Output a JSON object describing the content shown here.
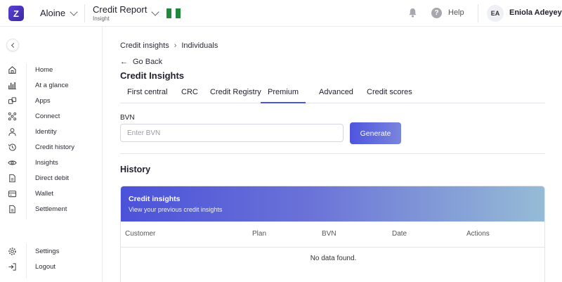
{
  "header": {
    "logo_glyph": "Z",
    "org_name": "Aloine",
    "product_title": "Credit Report",
    "product_subtitle": "Insight",
    "flag_colors": [
      "#1f8a3b",
      "#ffffff",
      "#1f8a3b"
    ],
    "help_glyph": "?",
    "help_label": "Help",
    "avatar_initials": "EA",
    "user_name": "Eniola Adeyeye"
  },
  "sidebar": {
    "items": [
      {
        "label": "Home",
        "icon": "home-icon"
      },
      {
        "label": "At a glance",
        "icon": "bar-chart-icon"
      },
      {
        "label": "Apps",
        "icon": "apps-icon"
      },
      {
        "label": "Connect",
        "icon": "connect-icon"
      },
      {
        "label": "Identity",
        "icon": "user-icon"
      },
      {
        "label": "Credit history",
        "icon": "history-icon"
      },
      {
        "label": "Insights",
        "icon": "eye-icon"
      },
      {
        "label": "Direct debit",
        "icon": "document-icon"
      },
      {
        "label": "Wallet",
        "icon": "wallet-icon"
      },
      {
        "label": "Settlement",
        "icon": "document-icon"
      }
    ],
    "footer_items": [
      {
        "label": "Settings",
        "icon": "gear-icon"
      },
      {
        "label": "Logout",
        "icon": "logout-icon"
      }
    ]
  },
  "breadcrumb": {
    "items": [
      "Credit insights",
      "Individuals"
    ],
    "separator": "›"
  },
  "go_back": {
    "arrow": "←",
    "label": "Go Back"
  },
  "page_title": "Credit Insights",
  "tabs": [
    {
      "label": "First central",
      "active": false
    },
    {
      "label": "CRC",
      "active": false
    },
    {
      "label": "Credit Registry",
      "active": false
    },
    {
      "label": "Premium",
      "active": true
    },
    {
      "label": "Advanced",
      "active": false
    },
    {
      "label": "Credit scores",
      "active": false
    }
  ],
  "form": {
    "bvn_label": "BVN",
    "bvn_placeholder": "Enter BVN",
    "bvn_value": "",
    "generate_label": "Generate"
  },
  "history": {
    "title": "History",
    "card_title": "Credit insights",
    "card_subtitle": "View your previous credit insights",
    "columns": [
      "Customer",
      "Plan",
      "BVN",
      "Date",
      "Actions"
    ],
    "empty_message": "No data found."
  },
  "colors": {
    "accent": "#4a55d8",
    "gradient_end": "#96bcd6"
  }
}
